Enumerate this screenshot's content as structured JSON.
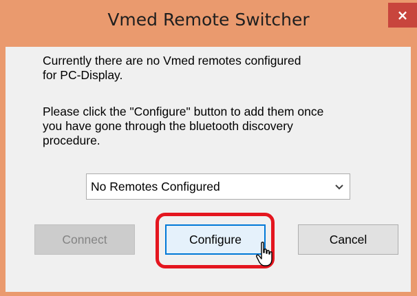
{
  "window": {
    "title": "Vmed Remote Switcher",
    "close_label": "×",
    "accent_color": "#ea9a6e"
  },
  "dialog": {
    "message1": [
      "Currently there are no Vmed remotes configured",
      "for PC-Display."
    ],
    "message2": [
      "Please click the \"Configure\" button to add them once",
      "you have gone through the bluetooth discovery",
      "procedure."
    ],
    "combo": {
      "selected": "No Remotes Configured",
      "arrow_icon": "chevron-down-icon"
    },
    "buttons": {
      "connect": "Connect",
      "configure": "Configure",
      "cancel": "Cancel"
    }
  },
  "annotation": {
    "highlight_color": "#e4161f",
    "cursor_icon": "hand-pointer-icon"
  }
}
